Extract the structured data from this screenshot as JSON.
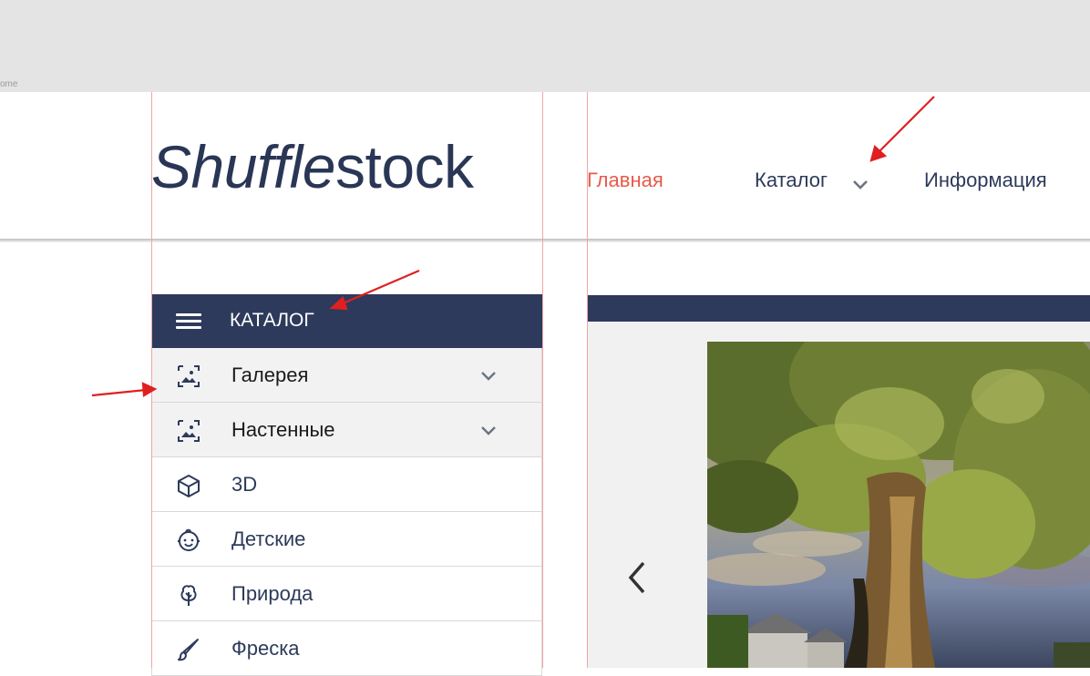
{
  "top_band": {
    "text": "ome"
  },
  "header": {
    "logo_part1": "Shuffle",
    "logo_part2": "stock",
    "nav": {
      "home": "Главная",
      "catalog": "Каталог",
      "info": "Информация"
    }
  },
  "sidebar": {
    "title": "КАТАЛОГ",
    "items": [
      {
        "label": "Галерея",
        "icon": "gallery-icon",
        "expandable": true
      },
      {
        "label": "Настенные",
        "icon": "gallery-icon",
        "expandable": true
      },
      {
        "label": "3D",
        "icon": "cube-icon",
        "expandable": false
      },
      {
        "label": "Детские",
        "icon": "baby-face-icon",
        "expandable": false
      },
      {
        "label": "Природа",
        "icon": "tree-icon",
        "expandable": false
      },
      {
        "label": "Фреска",
        "icon": "brush-icon",
        "expandable": false
      }
    ]
  },
  "colors": {
    "navy": "#2d3a5c",
    "accent_red": "#e85a4a",
    "annotation_arrow": "#e02020",
    "guide_line": "#f2a3a8"
  }
}
